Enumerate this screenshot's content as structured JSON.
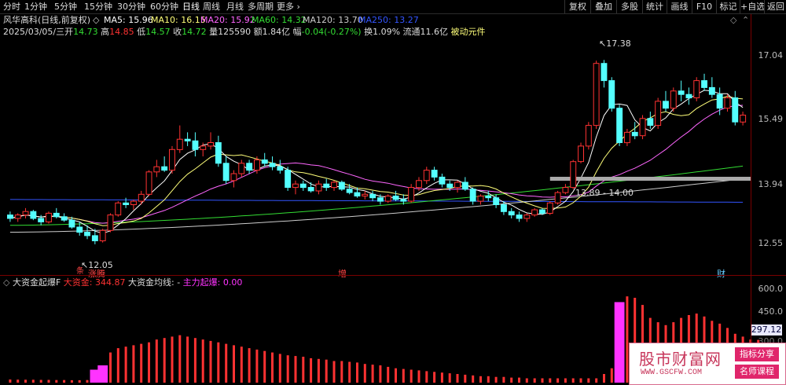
{
  "toolbar": {
    "tabs": [
      "分时",
      "1分钟",
      "5分钟",
      "15分钟",
      "30分钟",
      "60分钟",
      "日线",
      "周线",
      "月线",
      "多周期",
      "更多"
    ],
    "active_tab": "日线",
    "right_buttons": [
      "复权",
      "叠加",
      "多股",
      "统计",
      "画线",
      "F10",
      "标记",
      "+自选",
      "返回"
    ]
  },
  "stock_header": {
    "name": "风华高科(日线,前复权)",
    "ma5": "MA5: 15.96",
    "ma10": "MA10: 16.15",
    "ma20": "MA20: 15.92",
    "ma60": "MA60: 14.32",
    "ma120": "MA120: 13.70",
    "ma250": "MA250: 13.27"
  },
  "quote_line": {
    "date": "2025/03/05/三",
    "open_label": "开",
    "open": "14.73",
    "high_label": "高",
    "high": "14.85",
    "low_label": "低",
    "low": "14.57",
    "close_label": "收",
    "close": "14.72",
    "volume_label": "量",
    "volume": "125590",
    "amount_label": "额",
    "amount": "1.84亿",
    "change_label": "幅",
    "change": "-0.04(-0.27%)",
    "turnover_label": "换",
    "turnover": "1.09%",
    "float_label": "流通",
    "float": "11.6亿",
    "sector": "被动元件"
  },
  "price_axis": {
    "ticks": [
      "17.04",
      "15.49",
      "13.94",
      "12.55"
    ],
    "max": 18.0,
    "min": 11.5
  },
  "annotations": {
    "high_label": "17.38",
    "low_label": "12.05",
    "range_label": "13.89 - 14.00",
    "event_zhangteng": "涨腾",
    "event_zeng": "增",
    "event_cai": "财"
  },
  "indicator": {
    "title": "大资金起爆F",
    "big_money": "大资金: 344.87",
    "big_money_avg": "大资金均线: -",
    "main_force": "主力起爆: 0.00",
    "axis_ticks": [
      "600.0",
      "450.0",
      "300.0"
    ],
    "current_value": "297.12"
  },
  "watermark": {
    "main": "股市财富网",
    "url": "WWW.GSCFW.COM",
    "badge1": "指标分享",
    "badge2": "名师课程"
  },
  "colors": {
    "up": "#ff3232",
    "down": "#54ffff",
    "bg": "#000000",
    "ma5": "#ffffff",
    "ma10": "#ffff7a",
    "ma20": "#ff66ff",
    "ma60": "#33dd33",
    "ma120": "#cccccc",
    "ma250": "#3355ff",
    "indicator_magenta": "#ff33ff"
  },
  "chart_data": {
    "type": "candlestick",
    "candles": [
      [
        12.9,
        13.0,
        12.7,
        12.8
      ],
      [
        12.8,
        12.95,
        12.7,
        12.9
      ],
      [
        12.9,
        13.1,
        12.8,
        13.0
      ],
      [
        13.0,
        13.05,
        12.75,
        12.8
      ],
      [
        12.8,
        12.9,
        12.6,
        12.7
      ],
      [
        12.7,
        13.0,
        12.65,
        12.95
      ],
      [
        12.95,
        13.1,
        12.8,
        12.85
      ],
      [
        12.85,
        12.95,
        12.7,
        12.75
      ],
      [
        12.75,
        12.85,
        12.5,
        12.55
      ],
      [
        12.55,
        12.7,
        12.3,
        12.4
      ],
      [
        12.4,
        12.6,
        12.2,
        12.3
      ],
      [
        12.3,
        12.5,
        12.05,
        12.15
      ],
      [
        12.15,
        12.5,
        12.1,
        12.45
      ],
      [
        12.45,
        12.95,
        12.4,
        12.9
      ],
      [
        12.9,
        13.3,
        12.85,
        13.25
      ],
      [
        13.25,
        13.4,
        13.1,
        13.2
      ],
      [
        13.2,
        13.35,
        13.05,
        13.3
      ],
      [
        13.3,
        13.6,
        13.2,
        13.5
      ],
      [
        13.5,
        14.2,
        13.45,
        14.15
      ],
      [
        14.15,
        14.5,
        14.0,
        14.3
      ],
      [
        14.3,
        14.6,
        14.15,
        14.2
      ],
      [
        14.2,
        14.9,
        14.1,
        14.8
      ],
      [
        14.8,
        15.5,
        14.7,
        15.1
      ],
      [
        15.1,
        15.3,
        14.9,
        15.05
      ],
      [
        15.05,
        15.3,
        14.6,
        14.8
      ],
      [
        14.8,
        15.0,
        14.6,
        14.9
      ],
      [
        14.9,
        15.3,
        14.8,
        15.0
      ],
      [
        15.0,
        15.2,
        14.3,
        14.4
      ],
      [
        14.4,
        14.6,
        13.8,
        13.9
      ],
      [
        13.9,
        14.2,
        13.7,
        14.1
      ],
      [
        14.1,
        14.5,
        14.0,
        14.4
      ],
      [
        14.4,
        14.5,
        14.1,
        14.2
      ],
      [
        14.2,
        14.6,
        14.1,
        14.5
      ],
      [
        14.5,
        14.7,
        14.3,
        14.4
      ],
      [
        14.4,
        14.6,
        14.2,
        14.3
      ],
      [
        14.3,
        14.5,
        14.1,
        14.2
      ],
      [
        14.2,
        14.3,
        13.6,
        13.7
      ],
      [
        13.7,
        13.9,
        13.5,
        13.8
      ],
      [
        13.8,
        13.9,
        13.6,
        13.7
      ],
      [
        13.7,
        13.85,
        13.55,
        13.6
      ],
      [
        13.6,
        13.9,
        13.5,
        13.8
      ],
      [
        13.8,
        13.95,
        13.6,
        13.7
      ],
      [
        13.7,
        13.9,
        13.6,
        13.85
      ],
      [
        13.85,
        13.9,
        13.6,
        13.65
      ],
      [
        13.65,
        13.8,
        13.5,
        13.55
      ],
      [
        13.55,
        13.7,
        13.4,
        13.45
      ],
      [
        13.45,
        13.6,
        13.35,
        13.5
      ],
      [
        13.5,
        13.6,
        13.3,
        13.4
      ],
      [
        13.4,
        13.5,
        13.2,
        13.3
      ],
      [
        13.3,
        13.5,
        13.25,
        13.45
      ],
      [
        13.45,
        13.6,
        13.3,
        13.35
      ],
      [
        13.35,
        13.5,
        13.2,
        13.3
      ],
      [
        13.3,
        13.8,
        13.25,
        13.7
      ],
      [
        13.7,
        14.0,
        13.6,
        13.9
      ],
      [
        13.9,
        14.3,
        13.8,
        14.2
      ],
      [
        14.2,
        14.3,
        13.9,
        14.0
      ],
      [
        14.0,
        14.1,
        13.7,
        13.8
      ],
      [
        13.8,
        13.9,
        13.6,
        13.7
      ],
      [
        13.7,
        13.9,
        13.55,
        13.85
      ],
      [
        13.85,
        14.0,
        13.6,
        13.65
      ],
      [
        13.65,
        13.7,
        13.2,
        13.3
      ],
      [
        13.3,
        13.5,
        13.2,
        13.45
      ],
      [
        13.45,
        13.6,
        13.3,
        13.4
      ],
      [
        13.4,
        13.5,
        13.1,
        13.2
      ],
      [
        13.2,
        13.3,
        12.9,
        13.0
      ],
      [
        13.0,
        13.1,
        12.8,
        12.9
      ],
      [
        12.9,
        13.0,
        12.7,
        12.8
      ],
      [
        12.8,
        12.95,
        12.7,
        12.9
      ],
      [
        12.9,
        13.1,
        12.85,
        13.05
      ],
      [
        13.05,
        13.1,
        12.9,
        12.95
      ],
      [
        12.95,
        13.3,
        12.9,
        13.25
      ],
      [
        13.25,
        13.6,
        13.2,
        13.55
      ],
      [
        13.55,
        13.8,
        13.5,
        13.7
      ],
      [
        13.7,
        14.5,
        13.65,
        14.45
      ],
      [
        14.45,
        15.0,
        14.4,
        14.9
      ],
      [
        14.9,
        15.6,
        14.8,
        15.5
      ],
      [
        15.5,
        17.38,
        15.4,
        17.3
      ],
      [
        17.3,
        17.4,
        16.6,
        16.8
      ],
      [
        16.8,
        16.9,
        15.9,
        16.0
      ],
      [
        16.0,
        16.1,
        14.9,
        15.0
      ],
      [
        15.0,
        15.4,
        14.9,
        15.3
      ],
      [
        15.3,
        15.6,
        15.1,
        15.2
      ],
      [
        15.2,
        15.8,
        15.1,
        15.7
      ],
      [
        15.7,
        15.9,
        15.4,
        15.5
      ],
      [
        15.5,
        16.3,
        15.4,
        16.2
      ],
      [
        16.2,
        16.5,
        15.9,
        16.0
      ],
      [
        16.0,
        16.6,
        15.9,
        16.5
      ],
      [
        16.5,
        16.8,
        16.2,
        16.4
      ],
      [
        16.4,
        16.6,
        16.1,
        16.3
      ],
      [
        16.3,
        16.9,
        16.2,
        16.8
      ],
      [
        16.8,
        17.0,
        16.5,
        16.6
      ],
      [
        16.6,
        16.9,
        16.3,
        16.4
      ],
      [
        16.4,
        16.6,
        15.8,
        16.0
      ],
      [
        16.0,
        16.4,
        15.9,
        16.3
      ],
      [
        16.3,
        16.5,
        15.5,
        15.6
      ],
      [
        15.6,
        15.9,
        15.5,
        15.8
      ]
    ],
    "ma_series": {
      "ma250": {
        "start": 13.35,
        "end": 13.27
      },
      "ma120": {
        "start": 12.4,
        "end": 13.95
      },
      "ma60": {
        "start": 12.6,
        "end": 14.32
      }
    },
    "volume_bars": [
      22,
      21,
      20,
      20,
      19,
      19,
      18,
      18,
      17,
      17,
      18,
      90,
      120,
      210,
      240,
      250,
      260,
      270,
      280,
      300,
      310,
      320,
      330,
      320,
      310,
      300,
      290,
      280,
      270,
      260,
      250,
      240,
      230,
      220,
      210,
      200,
      190,
      185,
      180,
      170,
      165,
      160,
      150,
      150,
      145,
      140,
      130,
      125,
      120,
      110,
      100,
      95,
      90,
      85,
      80,
      75,
      70,
      65,
      60,
      55,
      50,
      45,
      45,
      40,
      40,
      35,
      35,
      30,
      30,
      30,
      30,
      30,
      30,
      30,
      30,
      30,
      30,
      60,
      100,
      560,
      600,
      590,
      540,
      450,
      420,
      400,
      420,
      450,
      470,
      480,
      460,
      430,
      410,
      380,
      340,
      320,
      300,
      297
    ],
    "magenta_bars": [
      11,
      12,
      79
    ],
    "vol_max": 650
  }
}
